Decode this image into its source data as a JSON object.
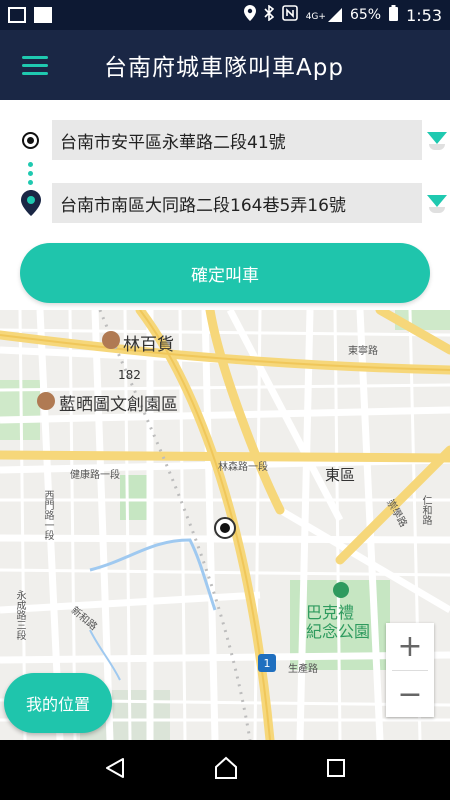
{
  "status_bar": {
    "network": "4G+",
    "battery": "65%",
    "time": "1:53"
  },
  "app_bar": {
    "title": "台南府城車隊叫車App",
    "menu_icon": "hamburger-menu-icon"
  },
  "route": {
    "origin": "台南市安平區永華路二段41號",
    "destination": "台南市南區大同路二段164巷5弄16號"
  },
  "confirm_button": "確定叫車",
  "map": {
    "labels": {
      "poi_1": "林百貨",
      "poi_2": "藍晒圖文創園區",
      "district": "東區",
      "park": "巴克禮\n紀念公園",
      "road_182": "182",
      "road_1": "1",
      "road_jiankang": "健康路一段",
      "road_linsen": "林森路一段",
      "road_dongning": "東寧路",
      "road_ximen": "西門路一段",
      "road_yongcheng": "永成路三段",
      "road_xinyi": "新和路",
      "road_shengchan": "生產路",
      "road_chongxue": "崇學路",
      "road_renhe": "仁和路"
    },
    "accent": "#1fc5ac",
    "park_color": "#2e9a5e"
  },
  "zoom": {
    "in": "+",
    "out": "−"
  },
  "my_location_button": "我的位置",
  "nav_icons": [
    "back-icon",
    "home-icon",
    "recents-icon"
  ]
}
